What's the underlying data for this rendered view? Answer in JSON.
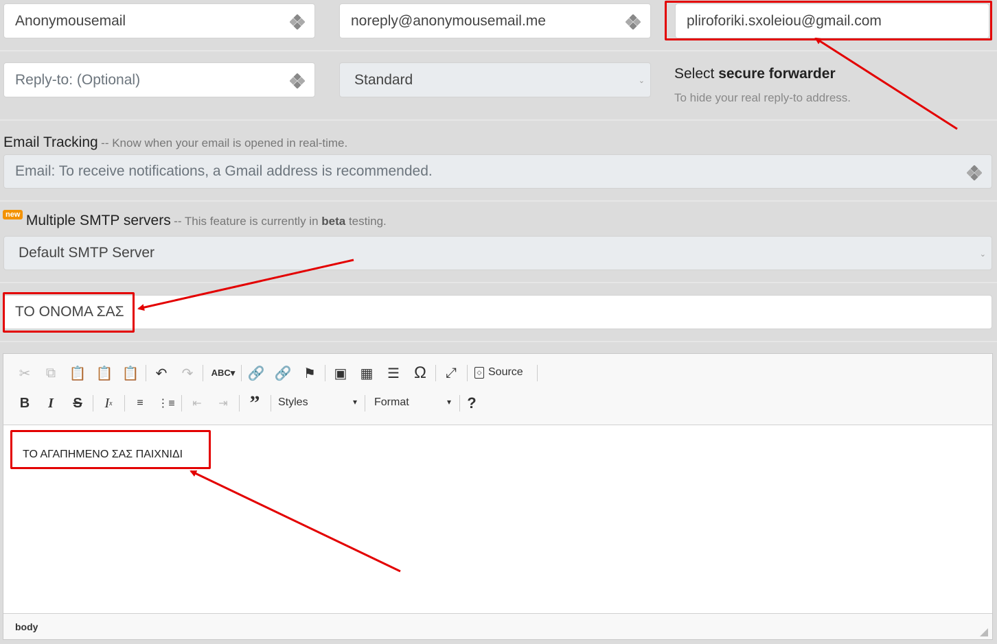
{
  "sender": {
    "from_name": "Anonymousemail",
    "from_email": "noreply@anonymousemail.me",
    "to_email": "pliroforiki.sxoleiou@gmail.com",
    "reply_to_placeholder": "Reply-to: (Optional)",
    "forwarder_value": "Standard",
    "forwarder_label_prefix": "Select ",
    "forwarder_label_bold": "secure forwarder",
    "forwarder_hint": "To hide your real reply-to address."
  },
  "tracking": {
    "title": "Email Tracking",
    "subtitle": "-- Know when your email is opened in real-time.",
    "placeholder": "Email: To receive notifications, a Gmail address is recommended."
  },
  "smtp": {
    "badge": "new",
    "title": "Multiple SMTP servers",
    "subtitle_prefix": "-- This feature is currently in ",
    "subtitle_bold": "beta",
    "subtitle_suffix": " testing.",
    "selected": "Default SMTP Server"
  },
  "subject": {
    "value": "ΤΟ ΟΝΟΜΑ ΣΑΣ"
  },
  "editor": {
    "source_label": "Source",
    "styles_label": "Styles",
    "format_label": "Format",
    "help_label": "?",
    "body_text": "ΤΟ ΑΓΑΠΗΜΕΝΟ ΣΑΣ ΠΑΙΧΝΙΔΙ",
    "status_path": "body"
  },
  "colors": {
    "annotation": "#e30000",
    "badge": "#f39200",
    "page_bg": "#dcdcdc",
    "input_disabled_bg": "#e9ecef"
  }
}
